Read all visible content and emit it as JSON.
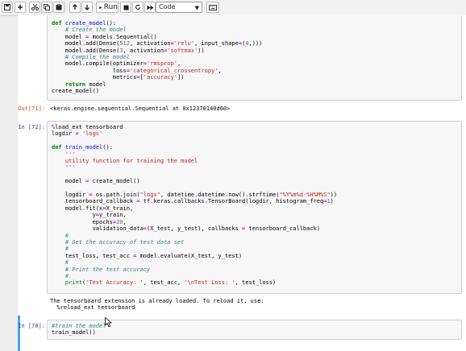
{
  "toolbar": {
    "buttons": [
      {
        "name": "save-button",
        "icon": "save-icon"
      },
      {
        "name": "insert-cell-button",
        "icon": "plus-icon"
      },
      {
        "name": "cut-button",
        "icon": "scissors-icon"
      },
      {
        "name": "copy-button",
        "icon": "copy-icon"
      },
      {
        "name": "paste-button",
        "icon": "paste-icon"
      },
      {
        "name": "move-up-button",
        "icon": "arrow-up-icon"
      },
      {
        "name": "move-down-button",
        "icon": "arrow-down-icon"
      },
      {
        "name": "run-button",
        "icon": "play-icon"
      },
      {
        "name": "interrupt-button",
        "icon": "stop-icon"
      },
      {
        "name": "restart-button",
        "icon": "refresh-icon"
      },
      {
        "name": "restart-run-all-button",
        "icon": "fast-forward-icon"
      },
      {
        "name": "command-palette-button",
        "icon": "keyboard-icon"
      }
    ],
    "run_label": "Run",
    "cell_type": "Code"
  },
  "cells": {
    "cell1": {
      "code": "def create_model():\n    # Create the model\n    model = models.Sequential()\n    model.add(Dense(512, activation='relu', input_shape=(4,)))\n    model.add(Dense(3, activation='softmax'))\n    # Compile the model\n    model.compile(optimizer='rmsprop',\n                  loss='categorical_crossentropy',\n                  metrics=['accuracy'])\n    return model\ncreate_model()"
    },
    "out71": {
      "prompt": "Out[71]:",
      "text": "<keras.engine.sequential.Sequential at 0x12370140d60>"
    },
    "in72": {
      "prompt": "In [72]:",
      "code": "%load_ext tensorboard\nlogdir = 'logs'\n\ndef train_model():\n    '''\n    utility function for training the model\n    '''\n\n    model = create_model()\n\n    logdir = os.path.join(\"logs\", datetime.datetime.now().strftime(\"%Y%m%d-%H%M%S\"))\n    tensorboard_callback = tf.keras.callbacks.TensorBoard(logdir, histogram_freq=1)\n    model.fit(x=X_train,\n            y=y_train,\n            epochs=20,\n            validation_data=(X_test, y_test), callbacks = tensorboard_callback)\n    #\n    # Get the accuracy of test data set\n    #\n    test_loss, test_acc = model.evaluate(X_test, y_test)\n    #\n    # Print the test accuracy\n    #\n    print('Test Accuracy: ', test_acc, '\\nTest Loss: ', test_loss)",
      "output": "The tensorboard extension is already loaded. To reload it, use:\n  %reload_ext tensorboard"
    },
    "in70": {
      "prompt": "In [70]:",
      "code": "#train the model\ntrain_model()"
    }
  }
}
